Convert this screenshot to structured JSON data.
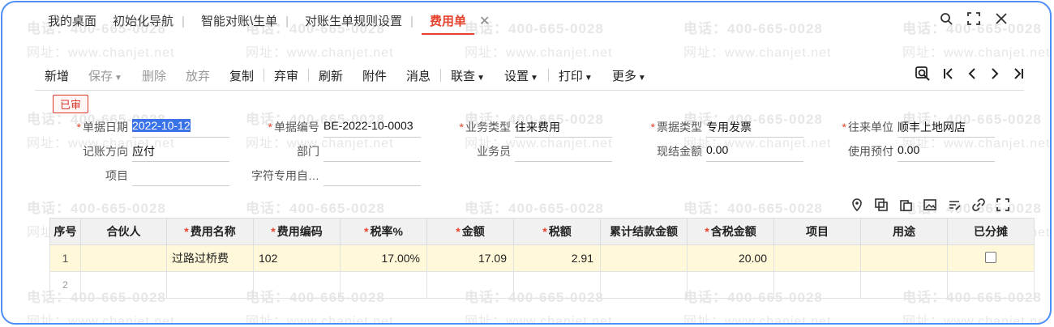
{
  "watermark": {
    "phone": "电话：400-665-0028",
    "site": "网址：www.chanjet.net"
  },
  "tabs": [
    {
      "label": "我的桌面"
    },
    {
      "label": "初始化导航"
    },
    {
      "label": "智能对账\\生单"
    },
    {
      "label": "对账生单规则设置"
    },
    {
      "label": "费用单",
      "active": true
    }
  ],
  "window_controls": {
    "search": "search-icon",
    "maximize": "maximize-icon",
    "close": "close-icon"
  },
  "toolbar": {
    "new": "新增",
    "save": "保存",
    "delete": "删除",
    "discard": "放弃",
    "copy": "复制",
    "unaudit": "弃审",
    "refresh": "刷新",
    "attach": "附件",
    "message": "消息",
    "link": "联查",
    "settings": "设置",
    "print": "打印",
    "more": "更多"
  },
  "status_badge": "已审",
  "form": {
    "doc_date": {
      "label": "单据日期",
      "value": "2022-10-12"
    },
    "doc_no": {
      "label": "单据编号",
      "value": "BE-2022-10-0003"
    },
    "biz_type": {
      "label": "业务类型",
      "value": "往来费用"
    },
    "bill_type": {
      "label": "票据类型",
      "value": "专用发票"
    },
    "partner": {
      "label": "往来单位",
      "value": "顺丰上地网店"
    },
    "direction": {
      "label": "记账方向",
      "value": "应付"
    },
    "dept": {
      "label": "部门",
      "value": ""
    },
    "salesman": {
      "label": "业务员",
      "value": ""
    },
    "cash_amount": {
      "label": "现结金额",
      "value": "0.00"
    },
    "prepay": {
      "label": "使用预付",
      "value": "0.00"
    },
    "project": {
      "label": "项目",
      "value": ""
    },
    "custom": {
      "label": "字符专用自…",
      "value": ""
    }
  },
  "grid": {
    "headers": [
      "序号",
      "合伙人",
      "费用名称",
      "费用编码",
      "税率%",
      "金额",
      "税额",
      "累计结款金额",
      "含税金额",
      "项目",
      "用途",
      "已分摊"
    ],
    "required": [
      false,
      false,
      true,
      true,
      true,
      true,
      true,
      false,
      true,
      false,
      false,
      false
    ],
    "rows": [
      {
        "seq": "1",
        "partner": "",
        "name": "过路过桥费",
        "code": "102",
        "rate": "17.00%",
        "amount": "17.09",
        "tax": "2.91",
        "settled": "",
        "total": "20.00",
        "project": "",
        "usage": "",
        "allocated": false
      },
      {
        "seq": "2",
        "partner": "",
        "name": "",
        "code": "",
        "rate": "",
        "amount": "",
        "tax": "",
        "settled": "",
        "total": "",
        "project": "",
        "usage": "",
        "allocated": null
      }
    ]
  }
}
